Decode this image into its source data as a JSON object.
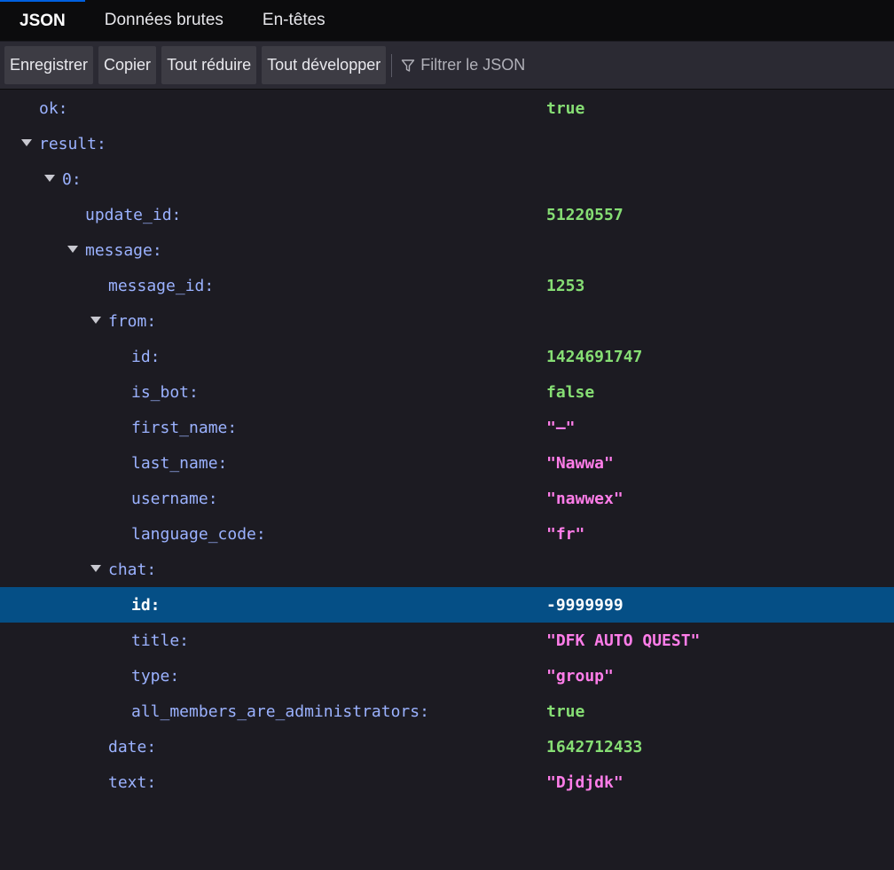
{
  "tabs": [
    {
      "label": "JSON",
      "active": true
    },
    {
      "label": "Données brutes",
      "active": false
    },
    {
      "label": "En-têtes",
      "active": false
    }
  ],
  "toolbar": {
    "save": "Enregistrer",
    "copy": "Copier",
    "collapse_all": "Tout réduire",
    "expand_all": "Tout développer",
    "filter_placeholder": "Filtrer le JSON"
  },
  "rows": [
    {
      "key": "ok:",
      "value": "true",
      "type": "bool",
      "depth": 0,
      "expandable": false
    },
    {
      "key": "result:",
      "value": "",
      "type": "",
      "depth": 0,
      "expandable": true
    },
    {
      "key": "0:",
      "value": "",
      "type": "",
      "depth": 1,
      "expandable": true
    },
    {
      "key": "update_id:",
      "value": "51220557",
      "type": "num",
      "depth": 2,
      "expandable": false
    },
    {
      "key": "message:",
      "value": "",
      "type": "",
      "depth": 2,
      "expandable": true
    },
    {
      "key": "message_id:",
      "value": "1253",
      "type": "num",
      "depth": 3,
      "expandable": false
    },
    {
      "key": "from:",
      "value": "",
      "type": "",
      "depth": 3,
      "expandable": true
    },
    {
      "key": "id:",
      "value": "1424691747",
      "type": "num",
      "depth": 4,
      "expandable": false
    },
    {
      "key": "is_bot:",
      "value": "false",
      "type": "bool",
      "depth": 4,
      "expandable": false
    },
    {
      "key": "first_name:",
      "value": "\"–\"",
      "type": "str",
      "depth": 4,
      "expandable": false
    },
    {
      "key": "last_name:",
      "value": "\"Nawwa\"",
      "type": "str",
      "depth": 4,
      "expandable": false
    },
    {
      "key": "username:",
      "value": "\"nawwex\"",
      "type": "str",
      "depth": 4,
      "expandable": false
    },
    {
      "key": "language_code:",
      "value": "\"fr\"",
      "type": "str",
      "depth": 4,
      "expandable": false
    },
    {
      "key": "chat:",
      "value": "",
      "type": "",
      "depth": 3,
      "expandable": true
    },
    {
      "key": "id:",
      "value": "-9999999",
      "type": "num",
      "depth": 4,
      "expandable": false,
      "selected": true
    },
    {
      "key": "title:",
      "value": "\"DFK AUTO QUEST\"",
      "type": "str",
      "depth": 4,
      "expandable": false
    },
    {
      "key": "type:",
      "value": "\"group\"",
      "type": "str",
      "depth": 4,
      "expandable": false
    },
    {
      "key": "all_members_are_administrators:",
      "value": "true",
      "type": "bool",
      "depth": 4,
      "expandable": false
    },
    {
      "key": "date:",
      "value": "1642712433",
      "type": "num",
      "depth": 3,
      "expandable": false
    },
    {
      "key": "text:",
      "value": "\"Djdjdk\"",
      "type": "str",
      "depth": 3,
      "expandable": false
    }
  ]
}
